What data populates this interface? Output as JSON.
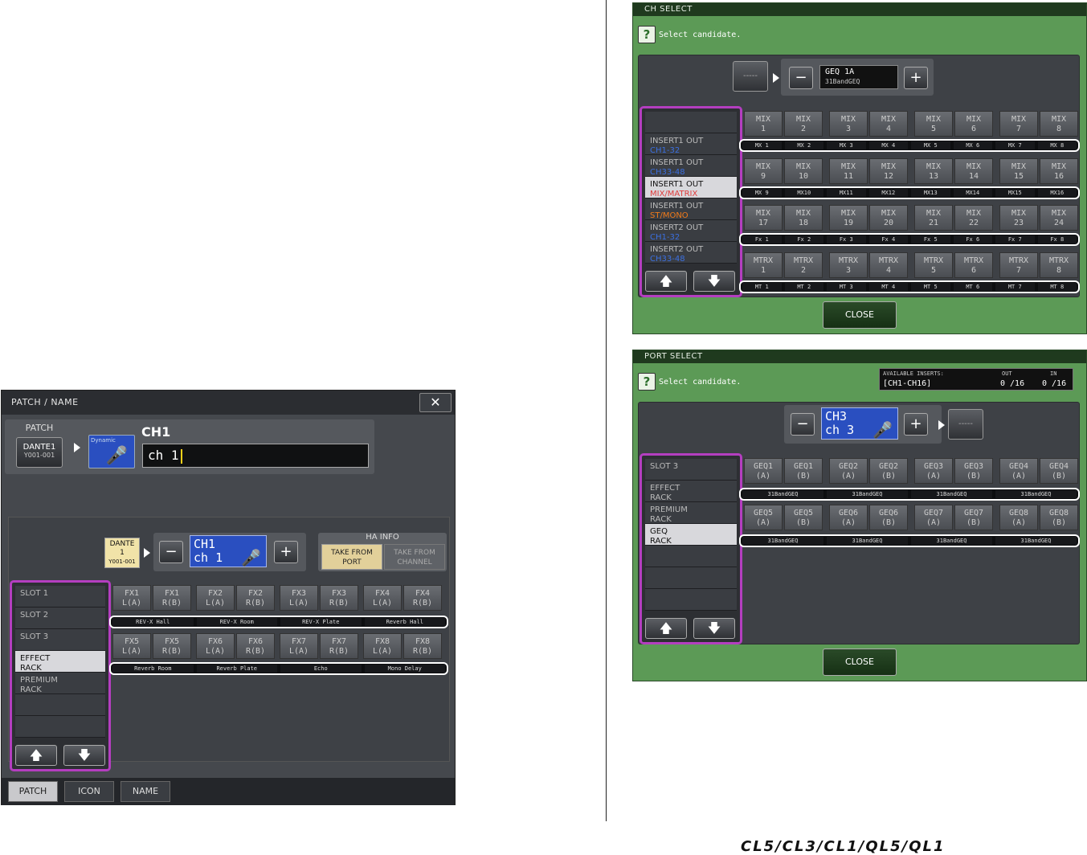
{
  "patch_name": {
    "title": "PATCH / NAME",
    "close": "✕",
    "patch_label": "PATCH",
    "patch_button": {
      "line1": "DANTE1",
      "line2": "Y001-001"
    },
    "icon_label": "Dynamic",
    "channel_title": "CH1",
    "name_value": "ch 1",
    "dante_tag": {
      "line1": "DANTE",
      "line2": "1",
      "line3": "Y001-001"
    },
    "stepper": {
      "minus": "−",
      "plus": "+",
      "line1": "CH1",
      "line2": "ch  1"
    },
    "ha_info": {
      "title": "HA INFO",
      "take_port": "TAKE FROM PORT",
      "take_channel": "TAKE FROM CHANNEL"
    },
    "list": [
      {
        "l1": "SLOT  1",
        "l2": ""
      },
      {
        "l1": "SLOT  2",
        "l2": ""
      },
      {
        "l1": "SLOT  3",
        "l2": ""
      },
      {
        "l1": "EFFECT",
        "l2": "RACK"
      },
      {
        "l1": "PREMIUM",
        "l2": "RACK"
      },
      {
        "l1": "",
        "l2": ""
      },
      {
        "l1": "",
        "l2": ""
      }
    ],
    "selected_index": 3,
    "up": "🡅",
    "down": "🡇",
    "row1_buttons": [
      [
        "FX1",
        "L(A)"
      ],
      [
        "FX1",
        "R(B)"
      ],
      [
        "FX2",
        "L(A)"
      ],
      [
        "FX2",
        "R(B)"
      ],
      [
        "FX3",
        "L(A)"
      ],
      [
        "FX3",
        "R(B)"
      ],
      [
        "FX4",
        "L(A)"
      ],
      [
        "FX4",
        "R(B)"
      ]
    ],
    "row1_names": [
      "REV-X Hall",
      "REV-X Room",
      "REV-X Plate",
      "Reverb Hall"
    ],
    "row2_buttons": [
      [
        "FX5",
        "L(A)"
      ],
      [
        "FX5",
        "R(B)"
      ],
      [
        "FX6",
        "L(A)"
      ],
      [
        "FX6",
        "R(B)"
      ],
      [
        "FX7",
        "L(A)"
      ],
      [
        "FX7",
        "R(B)"
      ],
      [
        "FX8",
        "L(A)"
      ],
      [
        "FX8",
        "R(B)"
      ]
    ],
    "row2_names": [
      "Reverb Room",
      "Reverb Plate",
      "Echo",
      "Mono Delay"
    ],
    "tabs": [
      "PATCH",
      "ICON",
      "NAME"
    ]
  },
  "ch_select": {
    "title": "CH SELECT",
    "q": "?",
    "prompt": "Select candidate.",
    "dash": "-----",
    "geq": {
      "line1": "GEQ 1A",
      "line2": "31BandGEQ"
    },
    "minus": "−",
    "plus": "+",
    "list": [
      {
        "l1": "",
        "l2": "",
        "color": ""
      },
      {
        "l1": "INSERT1 OUT",
        "l2": "CH1-32",
        "color": "#3b6fe0"
      },
      {
        "l1": "INSERT1 OUT",
        "l2": "CH33-48",
        "color": "#3b6fe0"
      },
      {
        "l1": "INSERT1 OUT",
        "l2": "MIX/MATRIX",
        "color": "#e03b3b"
      },
      {
        "l1": "INSERT1 OUT",
        "l2": "ST/MONO",
        "color": "#f07a1a"
      },
      {
        "l1": "INSERT2 OUT",
        "l2": "CH1-32",
        "color": "#3b6fe0"
      },
      {
        "l1": "INSERT2 OUT",
        "l2": "CH33-48",
        "color": "#3b6fe0"
      }
    ],
    "selected_index": 3,
    "rows": [
      {
        "buttons": [
          [
            "MIX",
            "1"
          ],
          [
            "MIX",
            "2"
          ],
          [
            "MIX",
            "3"
          ],
          [
            "MIX",
            "4"
          ],
          [
            "MIX",
            "5"
          ],
          [
            "MIX",
            "6"
          ],
          [
            "MIX",
            "7"
          ],
          [
            "MIX",
            "8"
          ]
        ],
        "labels": [
          "MX 1",
          "MX 2",
          "MX 3",
          "MX 4",
          "MX 5",
          "MX 6",
          "MX 7",
          "MX 8"
        ]
      },
      {
        "buttons": [
          [
            "MIX",
            "9"
          ],
          [
            "MIX",
            "10"
          ],
          [
            "MIX",
            "11"
          ],
          [
            "MIX",
            "12"
          ],
          [
            "MIX",
            "13"
          ],
          [
            "MIX",
            "14"
          ],
          [
            "MIX",
            "15"
          ],
          [
            "MIX",
            "16"
          ]
        ],
        "labels": [
          "MX 9",
          "MX10",
          "MX11",
          "MX12",
          "MX13",
          "MX14",
          "MX15",
          "MX16"
        ]
      },
      {
        "buttons": [
          [
            "MIX",
            "17"
          ],
          [
            "MIX",
            "18"
          ],
          [
            "MIX",
            "19"
          ],
          [
            "MIX",
            "20"
          ],
          [
            "MIX",
            "21"
          ],
          [
            "MIX",
            "22"
          ],
          [
            "MIX",
            "23"
          ],
          [
            "MIX",
            "24"
          ]
        ],
        "labels": [
          "Fx 1",
          "Fx 2",
          "Fx 3",
          "Fx 4",
          "Fx 5",
          "Fx 6",
          "Fx 7",
          "Fx 8"
        ]
      },
      {
        "buttons": [
          [
            "MTRX",
            "1"
          ],
          [
            "MTRX",
            "2"
          ],
          [
            "MTRX",
            "3"
          ],
          [
            "MTRX",
            "4"
          ],
          [
            "MTRX",
            "5"
          ],
          [
            "MTRX",
            "6"
          ],
          [
            "MTRX",
            "7"
          ],
          [
            "MTRX",
            "8"
          ]
        ],
        "labels": [
          "MT 1",
          "MT 2",
          "MT 3",
          "MT 4",
          "MT 5",
          "MT 6",
          "MT 7",
          "MT 8"
        ]
      }
    ],
    "close": "CLOSE"
  },
  "port_select": {
    "title": "PORT SELECT",
    "q": "?",
    "prompt": "Select candidate.",
    "available": {
      "label": "AVAILABLE INSERTS:",
      "range": "[CH1-CH16]",
      "out_label": "OUT",
      "out_value": "0 /16",
      "in_label": "IN",
      "in_value": "0 /16"
    },
    "minus": "−",
    "plus": "+",
    "stepper": {
      "line1": "CH3",
      "line2": "ch  3"
    },
    "dash": "-----",
    "list": [
      {
        "l1": "SLOT  3",
        "l2": ""
      },
      {
        "l1": "EFFECT",
        "l2": "RACK"
      },
      {
        "l1": "PREMIUM",
        "l2": "RACK"
      },
      {
        "l1": "GEQ",
        "l2": "RACK"
      },
      {
        "l1": "",
        "l2": ""
      },
      {
        "l1": "",
        "l2": ""
      },
      {
        "l1": "",
        "l2": ""
      }
    ],
    "selected_index": 3,
    "rows": [
      {
        "buttons": [
          [
            "GEQ1",
            "(A)"
          ],
          [
            "GEQ1",
            "(B)"
          ],
          [
            "GEQ2",
            "(A)"
          ],
          [
            "GEQ2",
            "(B)"
          ],
          [
            "GEQ3",
            "(A)"
          ],
          [
            "GEQ3",
            "(B)"
          ],
          [
            "GEQ4",
            "(A)"
          ],
          [
            "GEQ4",
            "(B)"
          ]
        ],
        "labels": [
          "31BandGEQ",
          "31BandGEQ",
          "31BandGEQ",
          "31BandGEQ"
        ]
      },
      {
        "buttons": [
          [
            "GEQ5",
            "(A)"
          ],
          [
            "GEQ5",
            "(B)"
          ],
          [
            "GEQ6",
            "(A)"
          ],
          [
            "GEQ6",
            "(B)"
          ],
          [
            "GEQ7",
            "(A)"
          ],
          [
            "GEQ7",
            "(B)"
          ],
          [
            "GEQ8",
            "(A)"
          ],
          [
            "GEQ8",
            "(B)"
          ]
        ],
        "labels": [
          "31BandGEQ",
          "31BandGEQ",
          "31BandGEQ",
          "31BandGEQ"
        ]
      }
    ],
    "close": "CLOSE"
  },
  "footer": {
    "models": "CL5/CL3/CL1/QL5/QL1"
  },
  "colors": {
    "accent_purple": "#b43ec0",
    "window_green": "#5c9a56",
    "channel_blue": "#2a4fc0"
  }
}
